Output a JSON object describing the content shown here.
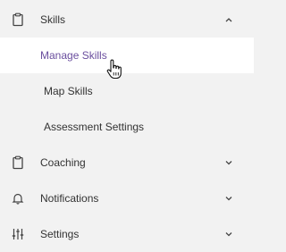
{
  "menu": {
    "skills": {
      "label": "Skills",
      "icon": "clipboard-icon",
      "expanded": true
    },
    "skills_sub": [
      {
        "label": "Manage Skills",
        "active": true
      },
      {
        "label": "Map Skills",
        "active": false
      },
      {
        "label": "Assessment Settings",
        "active": false
      }
    ],
    "coaching": {
      "label": "Coaching",
      "icon": "clipboard-icon"
    },
    "notifications": {
      "label": "Notifications",
      "icon": "bell-icon"
    },
    "settings": {
      "label": "Settings",
      "icon": "sliders-icon"
    }
  },
  "colors": {
    "accent": "#6a4e9e",
    "background": "#f2f2f2",
    "active_bg": "#ffffff",
    "text": "#333333"
  }
}
